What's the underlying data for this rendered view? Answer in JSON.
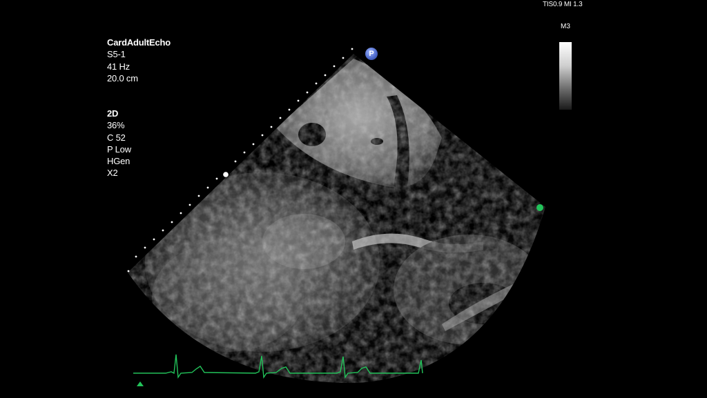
{
  "preset": {
    "exam": "CardAdultEcho",
    "probe": "S5-1",
    "frame_rate": "41 Hz",
    "depth": "20.0 cm"
  },
  "mode": {
    "name": "2D",
    "gain": "36%",
    "compression": "C 52",
    "power": "P Low",
    "frequency": "HGen",
    "zoom": "X2"
  },
  "safety": {
    "indices": "TIS0.9 MI 1.3"
  },
  "gray_map": {
    "label": "M3"
  },
  "orientation_marker": {
    "label": "P"
  },
  "colors": {
    "background": "#000000",
    "ecg_trace": "#22c35a",
    "focus_marker": "#22c35a",
    "marker_badge": "#4a66c8"
  },
  "icons": {
    "orientation": "orientation-marker-icon",
    "focus": "focus-dot-icon",
    "ecg_trigger": "ecg-trigger-icon"
  }
}
